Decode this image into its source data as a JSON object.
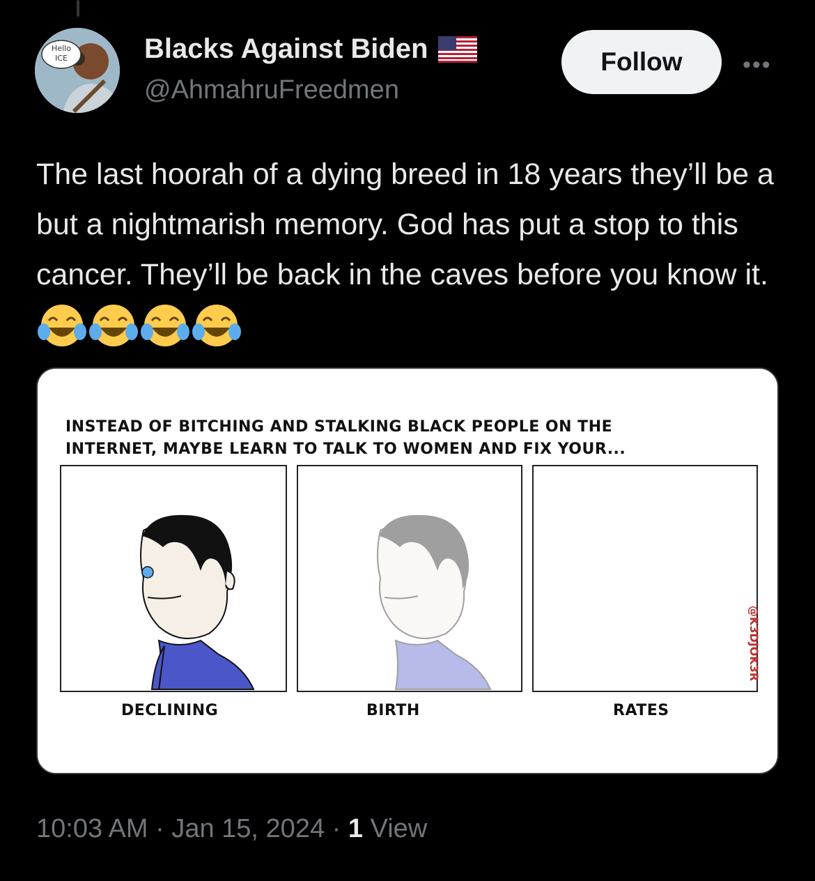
{
  "author": {
    "name": "Blacks Against Biden",
    "handle": "@AhmahruFreedmen",
    "avatar_text": [
      "Hello",
      "ICE"
    ],
    "badge_icon": "us-flag-icon"
  },
  "actions": {
    "follow_label": "Follow",
    "more_icon": "more-icon"
  },
  "tweet": {
    "text": "The last hoorah of a dying breed in 18 years they’ll be a but a nightmarish memory. God has put a stop to this cancer. They’ll be back in the caves before you know it.",
    "emoji": [
      "face-with-tears-of-joy",
      "face-with-tears-of-joy",
      "face-with-tears-of-joy",
      "face-with-tears-of-joy"
    ]
  },
  "comic": {
    "caption_line1": "INSTEAD OF BITCHING AND STALKING BLACK PEOPLE ON THE",
    "caption_line2": "INTERNET, MAYBE LEARN TO TALK TO WOMEN AND FIX YOUR...",
    "panels": [
      {
        "label": "DECLINING"
      },
      {
        "label": "BIRTH"
      },
      {
        "label": "RATES"
      }
    ],
    "credit": "@K3DJOK3R"
  },
  "meta": {
    "time": "10:03 AM",
    "date": "Jan 15, 2024",
    "views_count": "1",
    "views_label": "View"
  },
  "colors": {
    "background": "#000000",
    "text": "#e7e9ea",
    "muted": "#71767b",
    "follow_bg": "#eff3f4"
  }
}
